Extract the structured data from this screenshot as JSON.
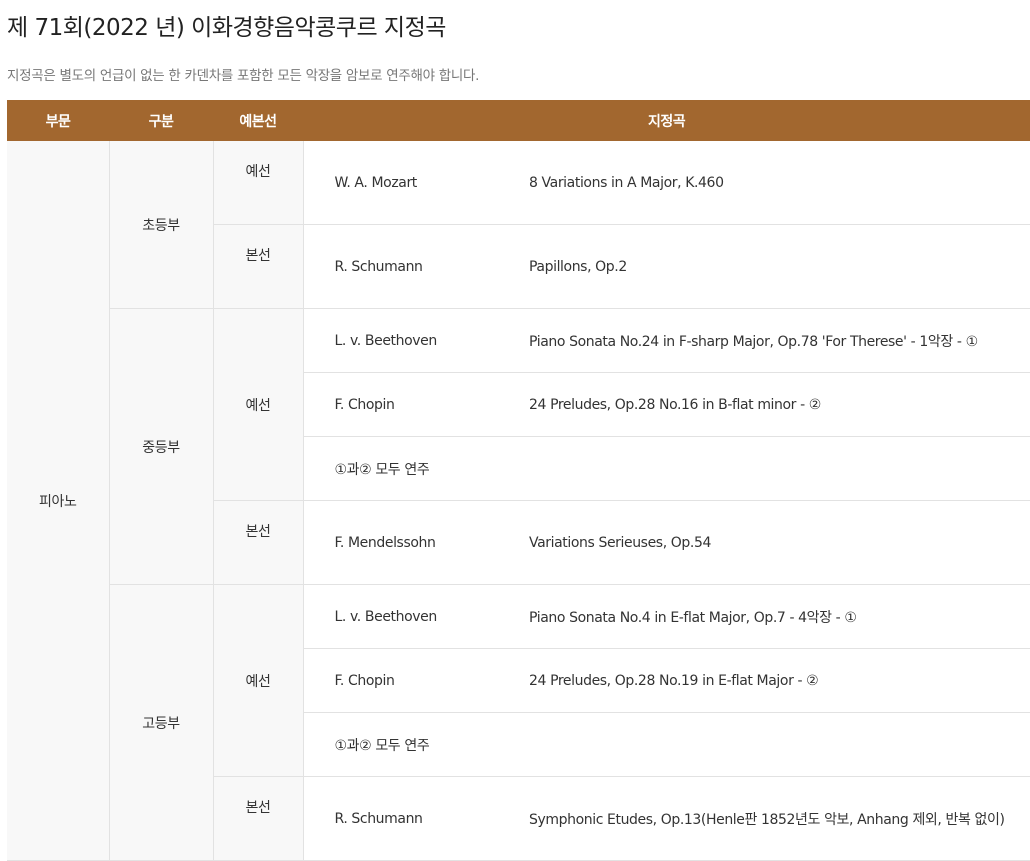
{
  "page": {
    "title": "제 71회(2022 년) 이화경향음악콩쿠르 지정곡",
    "notice": "지정곡은 별도의 언급이 없는 한 카덴차를 포함한 모든 악장을 암보로 연주해야 합니다."
  },
  "table": {
    "headers": [
      "부문",
      "구분",
      "예본선",
      "지정곡"
    ],
    "division": "피아노",
    "levels": [
      {
        "name": "초등부",
        "rounds": [
          {
            "name": "예선",
            "rows": [
              {
                "composer": "W. A. Mozart",
                "work": "8 Variations in A Major, K.460"
              }
            ]
          },
          {
            "name": "본선",
            "rows": [
              {
                "composer": "R. Schumann",
                "work": "Papillons, Op.2"
              }
            ]
          }
        ]
      },
      {
        "name": "중등부",
        "rounds": [
          {
            "name": "예선",
            "rows": [
              {
                "composer": "L. v. Beethoven",
                "work": "Piano Sonata No.24 in F-sharp Major, Op.78 'For Therese' - 1악장 - ①"
              },
              {
                "composer": "F. Chopin",
                "work": "24 Preludes, Op.28 No.16 in B-flat minor - ②"
              },
              {
                "composer": "①과② 모두 연주",
                "work": ""
              }
            ]
          },
          {
            "name": "본선",
            "rows": [
              {
                "composer": "F. Mendelssohn",
                "work": "Variations Serieuses, Op.54"
              }
            ]
          }
        ]
      },
      {
        "name": "고등부",
        "rounds": [
          {
            "name": "예선",
            "rows": [
              {
                "composer": "L. v. Beethoven",
                "work": "Piano Sonata No.4 in E-flat Major, Op.7 - 4악장 - ①"
              },
              {
                "composer": "F. Chopin",
                "work": "24 Preludes, Op.28 No.19 in E-flat Major - ②"
              },
              {
                "composer": "①과② 모두 연주",
                "work": ""
              }
            ]
          },
          {
            "name": "본선",
            "rows": [
              {
                "composer": "R. Schumann",
                "work": "Symphonic Etudes, Op.13(Henle판 1852년도 악보, Anhang 제외, 반복 없이)"
              }
            ]
          }
        ]
      }
    ]
  }
}
